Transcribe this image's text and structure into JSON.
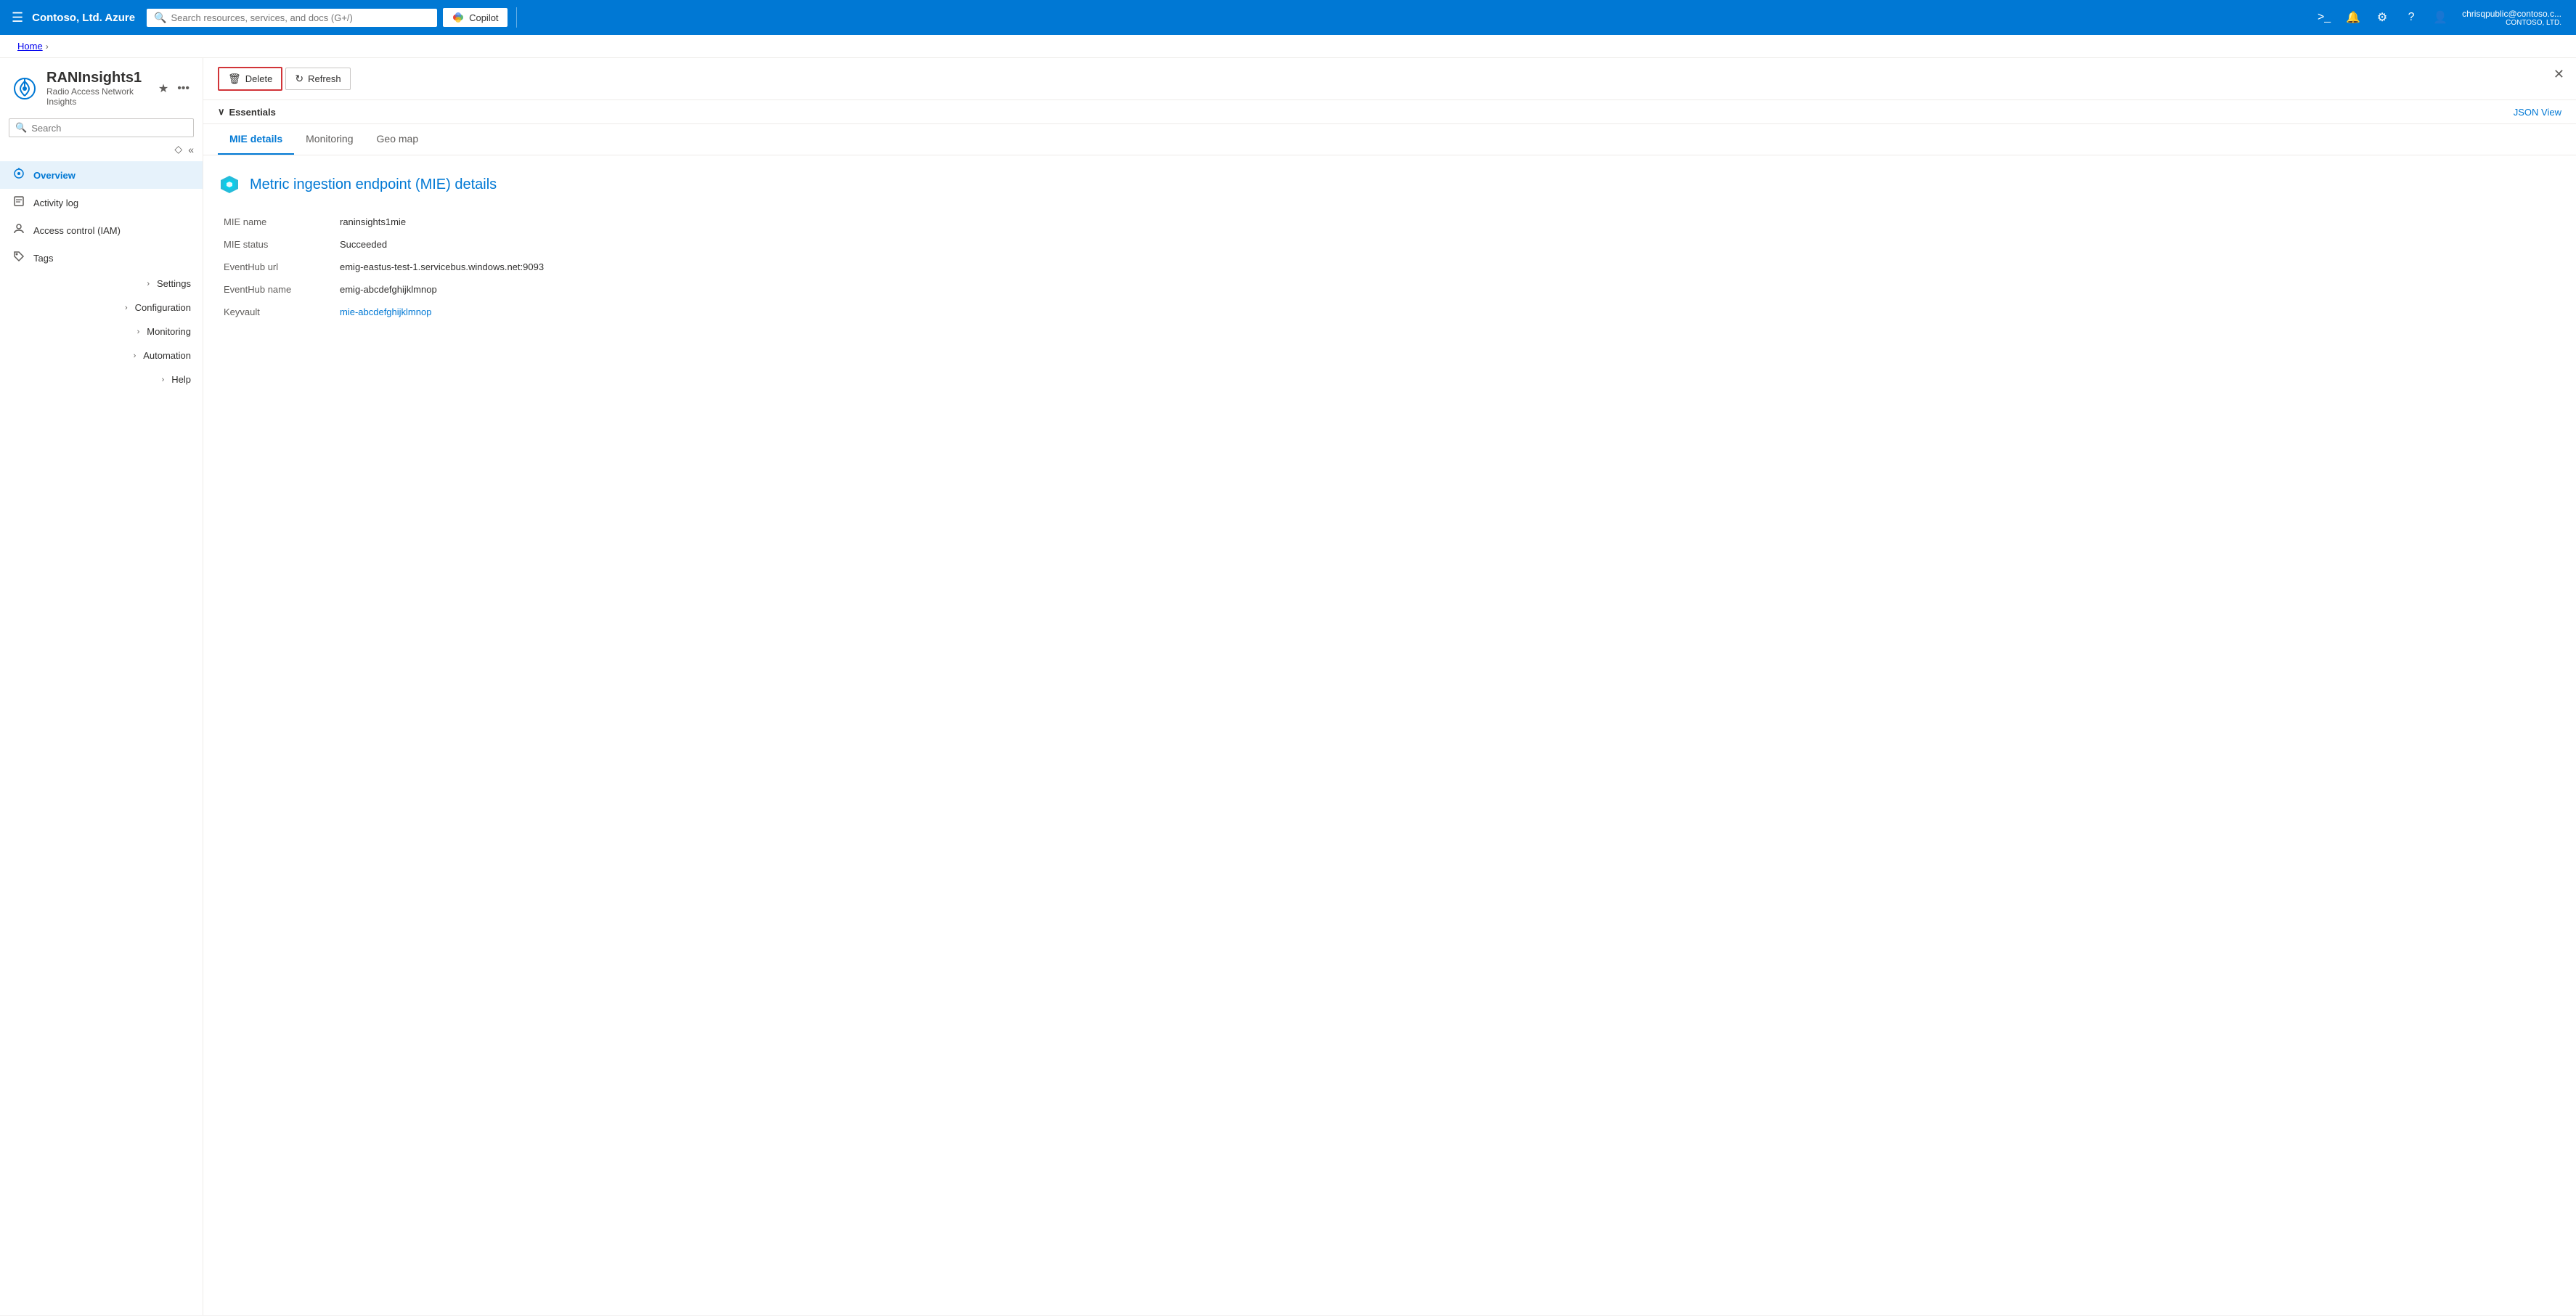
{
  "topnav": {
    "brand": "Contoso, Ltd. Azure",
    "search_placeholder": "Search resources, services, and docs (G+/)",
    "copilot_label": "Copilot",
    "user_name": "chrisqpublic@contoso.c...",
    "user_org": "CONTOSO, LTD.",
    "icons": {
      "terminal": "⌨",
      "bell": "🔔",
      "settings": "⚙",
      "help": "?",
      "feedback": "💬"
    }
  },
  "breadcrumb": {
    "home": "Home",
    "separator": "›"
  },
  "resource": {
    "title": "RANInsights1",
    "subtitle": "Radio Access Network Insights"
  },
  "sidebar": {
    "search_placeholder": "Search",
    "nav_items": [
      {
        "id": "overview",
        "label": "Overview",
        "icon": "📡",
        "active": true,
        "expandable": false
      },
      {
        "id": "activity-log",
        "label": "Activity log",
        "icon": "📋",
        "active": false,
        "expandable": false
      },
      {
        "id": "access-control",
        "label": "Access control (IAM)",
        "icon": "👤",
        "active": false,
        "expandable": false
      },
      {
        "id": "tags",
        "label": "Tags",
        "icon": "🏷",
        "active": false,
        "expandable": false
      },
      {
        "id": "settings",
        "label": "Settings",
        "icon": "",
        "active": false,
        "expandable": true
      },
      {
        "id": "configuration",
        "label": "Configuration",
        "icon": "",
        "active": false,
        "expandable": true
      },
      {
        "id": "monitoring",
        "label": "Monitoring",
        "icon": "",
        "active": false,
        "expandable": true
      },
      {
        "id": "automation",
        "label": "Automation",
        "icon": "",
        "active": false,
        "expandable": true
      },
      {
        "id": "help",
        "label": "Help",
        "icon": "",
        "active": false,
        "expandable": true
      }
    ]
  },
  "toolbar": {
    "delete_label": "Delete",
    "refresh_label": "Refresh"
  },
  "essentials": {
    "toggle_label": "Essentials",
    "json_view_label": "JSON View"
  },
  "tabs": [
    {
      "id": "mie-details",
      "label": "MIE details",
      "active": true
    },
    {
      "id": "monitoring",
      "label": "Monitoring",
      "active": false
    },
    {
      "id": "geo-map",
      "label": "Geo map",
      "active": false
    }
  ],
  "mie": {
    "title": "Metric ingestion endpoint (MIE) details",
    "fields": [
      {
        "label": "MIE name",
        "value": "raninsights1mie",
        "link": false
      },
      {
        "label": "MIE status",
        "value": "Succeeded",
        "link": false
      },
      {
        "label": "EventHub url",
        "value": "emig-eastus-test-1.servicebus.windows.net:9093",
        "link": false
      },
      {
        "label": "EventHub name",
        "value": "emig-abcdefghijklmnop",
        "link": false
      },
      {
        "label": "Keyvault",
        "value": "mie-abcdefghijklmnop",
        "link": true
      }
    ]
  }
}
